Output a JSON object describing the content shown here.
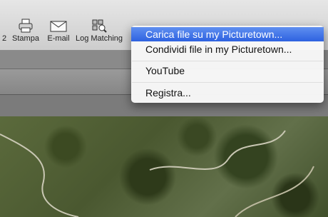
{
  "toolbar": {
    "items": [
      {
        "label": "2",
        "icon": "partial-icon"
      },
      {
        "label": "Stampa",
        "icon": "printer-icon"
      },
      {
        "label": "E-mail",
        "icon": "envelope-icon"
      },
      {
        "label": "Log Matching",
        "icon": "log-matching-icon"
      }
    ]
  },
  "menu": {
    "items": [
      {
        "label": "Carica file su my Picturetown..."
      },
      {
        "label": "Condividi file in my Picturetown..."
      },
      {
        "label": "YouTube"
      },
      {
        "label": "Registra..."
      }
    ]
  }
}
